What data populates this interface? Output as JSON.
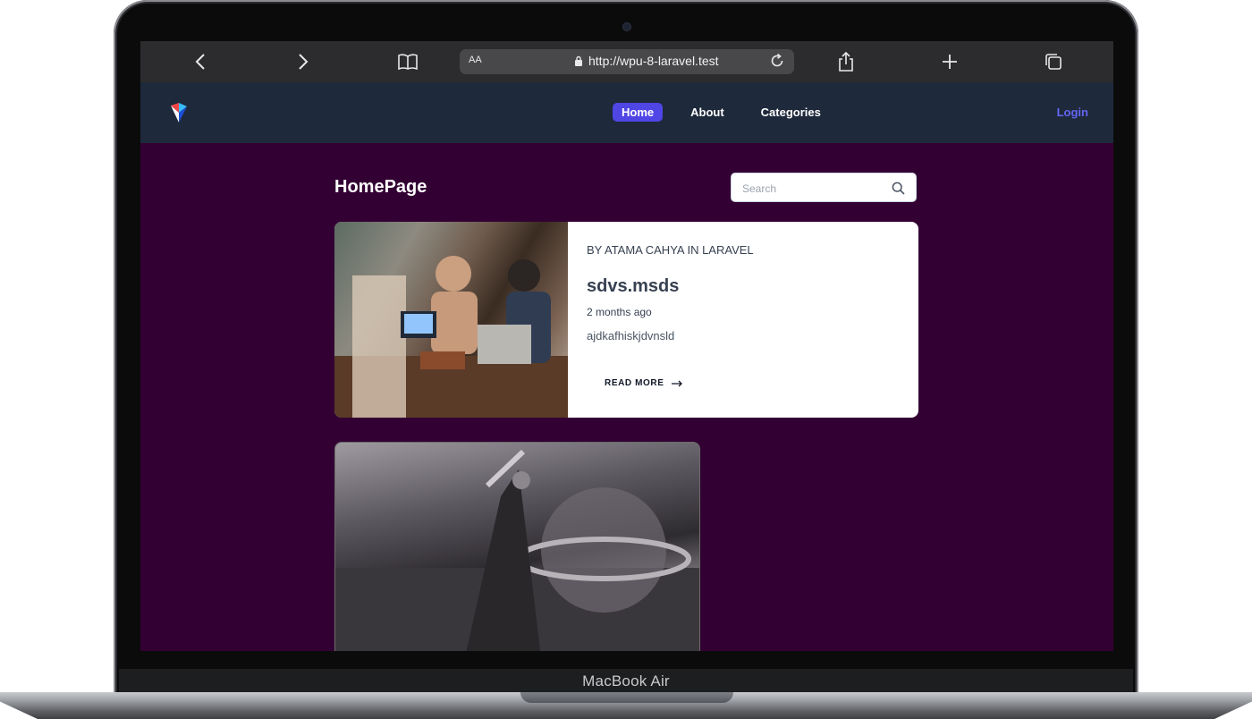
{
  "device": {
    "label": "MacBook Air"
  },
  "browser": {
    "text_size_label": "AA",
    "url": "http://wpu-8-laravel.test"
  },
  "nav": {
    "links": [
      {
        "label": "Home",
        "active": true
      },
      {
        "label": "About",
        "active": false
      },
      {
        "label": "Categories",
        "active": false
      }
    ],
    "login_label": "Login"
  },
  "page": {
    "title": "HomePage",
    "search": {
      "placeholder": "Search"
    }
  },
  "posts": [
    {
      "meta": "BY ATAMA CAHYA IN LARAVEL",
      "title": "sdvs.msds",
      "date": "2 months ago",
      "excerpt": "ajdkafhiskjdvnsld",
      "read_more": "READ MORE"
    }
  ],
  "colors": {
    "page_background": "#330033",
    "nav_background": "#1e293b",
    "accent": "#4f46e5"
  }
}
